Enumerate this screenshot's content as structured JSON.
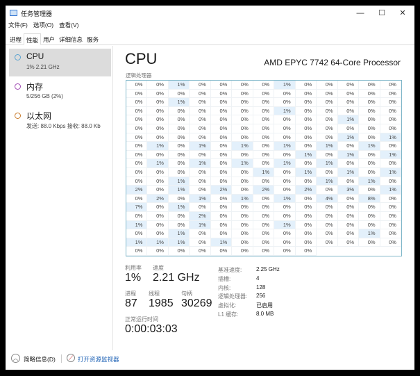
{
  "window": {
    "title": "任务管理器",
    "minimize": "—",
    "maximize": "☐",
    "close": "✕"
  },
  "menu": [
    "文件(F)",
    "选项(O)",
    "查看(V)"
  ],
  "tabs": [
    "进程",
    "性能",
    "用户",
    "详细信息",
    "服务"
  ],
  "sidebar": [
    {
      "name": "CPU",
      "sub": "1% 2.21 GHz",
      "color": "#5ba3d0"
    },
    {
      "name": "内存",
      "sub": "5/256 GB (2%)",
      "color": "#a24bb5"
    },
    {
      "name": "以太网",
      "sub": "发送: 88.0 Kbps 接收: 88.0 Kb",
      "color": "#c97c2d"
    }
  ],
  "main": {
    "title": "CPU",
    "model": "AMD EPYC 7742 64-Core Processor",
    "grid_label": "逻辑处理器"
  },
  "cpu_usage": [
    0,
    0,
    1,
    0,
    0,
    0,
    0,
    1,
    0,
    0,
    0,
    0,
    0,
    0,
    0,
    0,
    0,
    0,
    0,
    0,
    0,
    0,
    0,
    0,
    0,
    0,
    0,
    0,
    1,
    0,
    0,
    0,
    0,
    0,
    0,
    0,
    0,
    0,
    0,
    0,
    0,
    0,
    0,
    0,
    0,
    0,
    1,
    0,
    0,
    0,
    0,
    0,
    0,
    0,
    0,
    0,
    0,
    0,
    0,
    0,
    0,
    0,
    1,
    0,
    0,
    0,
    0,
    0,
    0,
    0,
    0,
    0,
    0,
    0,
    0,
    0,
    0,
    0,
    0,
    0,
    0,
    0,
    0,
    0,
    0,
    0,
    0,
    0,
    1,
    0,
    1,
    0,
    1,
    0,
    1,
    0,
    1,
    0,
    1,
    0,
    1,
    0,
    1,
    0,
    0,
    0,
    0,
    0,
    0,
    0,
    0,
    0,
    1,
    0,
    1,
    0,
    1,
    0,
    1,
    0,
    1,
    0,
    1,
    0,
    1,
    0,
    1,
    0,
    0,
    0,
    0,
    0,
    0,
    0,
    0,
    0,
    1,
    0,
    1,
    0,
    1,
    0,
    1,
    0,
    0,
    1,
    0,
    0,
    0,
    0,
    0,
    0,
    1,
    0,
    1,
    0,
    2,
    0,
    1,
    0,
    2,
    0,
    2,
    0,
    2,
    0,
    3,
    0,
    1,
    0,
    2,
    0,
    1,
    0,
    1,
    0,
    1,
    0,
    4,
    0,
    8,
    0,
    7,
    0,
    1,
    0,
    0,
    0,
    0,
    0,
    0,
    0,
    0,
    0,
    0,
    0,
    0,
    0,
    2,
    0,
    0,
    0,
    0,
    0,
    0,
    0,
    0,
    0,
    1,
    0,
    0,
    1,
    0,
    0,
    0,
    1,
    0,
    0,
    0,
    0,
    0,
    0,
    0,
    1,
    0,
    0,
    0,
    0,
    0,
    0,
    0,
    0,
    1,
    0,
    1,
    1,
    1,
    0,
    1,
    0,
    0,
    0,
    0,
    0,
    0,
    0,
    0,
    0,
    0,
    0,
    0,
    0,
    0,
    0,
    0,
    0
  ],
  "stats": {
    "util_label": "利用率",
    "util": "1%",
    "speed_label": "速度",
    "speed": "2.21 GHz",
    "proc_label": "进程",
    "proc": "87",
    "thread_label": "线程",
    "thread": "1985",
    "handle_label": "句柄",
    "handle": "30269",
    "uptime_label": "正常运行时间",
    "uptime": "0:00:03:03"
  },
  "specs": [
    {
      "k": "基准速度:",
      "v": "2.25 GHz"
    },
    {
      "k": "插槽:",
      "v": "4"
    },
    {
      "k": "内核:",
      "v": "128"
    },
    {
      "k": "逻辑处理器:",
      "v": "256"
    },
    {
      "k": "虚拟化:",
      "v": "已启用"
    },
    {
      "k": "L1 缓存:",
      "v": "8.0 MB"
    }
  ],
  "footer": {
    "brief": "简略信息(D)",
    "monitor": "打开资源监视器"
  }
}
